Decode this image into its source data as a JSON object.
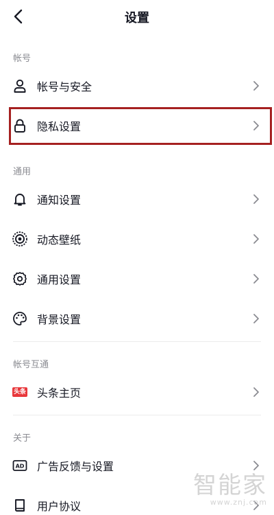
{
  "header": {
    "title": "设置"
  },
  "sections": {
    "account": {
      "label": "帐号"
    },
    "general": {
      "label": "通用"
    },
    "interop": {
      "label": "帐号互通"
    },
    "about": {
      "label": "关于"
    }
  },
  "rows": {
    "account_security": {
      "label": "帐号与安全",
      "icon": "user-icon"
    },
    "privacy": {
      "label": "隐私设置",
      "icon": "lock-icon"
    },
    "notifications": {
      "label": "通知设置",
      "icon": "bell-icon"
    },
    "live_wallpaper": {
      "label": "动态壁纸",
      "icon": "wallpaper-icon"
    },
    "general_settings": {
      "label": "通用设置",
      "icon": "gear-icon"
    },
    "background": {
      "label": "背景设置",
      "icon": "palette-icon"
    },
    "toutiao": {
      "label": "头条主页",
      "icon": "toutiao-icon",
      "icon_text": "头条"
    },
    "ad_feedback": {
      "label": "广告反馈与设置",
      "icon": "ad-icon",
      "icon_text": "AD"
    },
    "user_agreement": {
      "label": "用户协议",
      "icon": "book-icon"
    }
  },
  "watermark": {
    "main": "智能家",
    "sub": "www.znj.com"
  },
  "colors": {
    "highlight": "#a52020",
    "toutiao": "#e8373b",
    "section_text": "#8a8b91"
  }
}
